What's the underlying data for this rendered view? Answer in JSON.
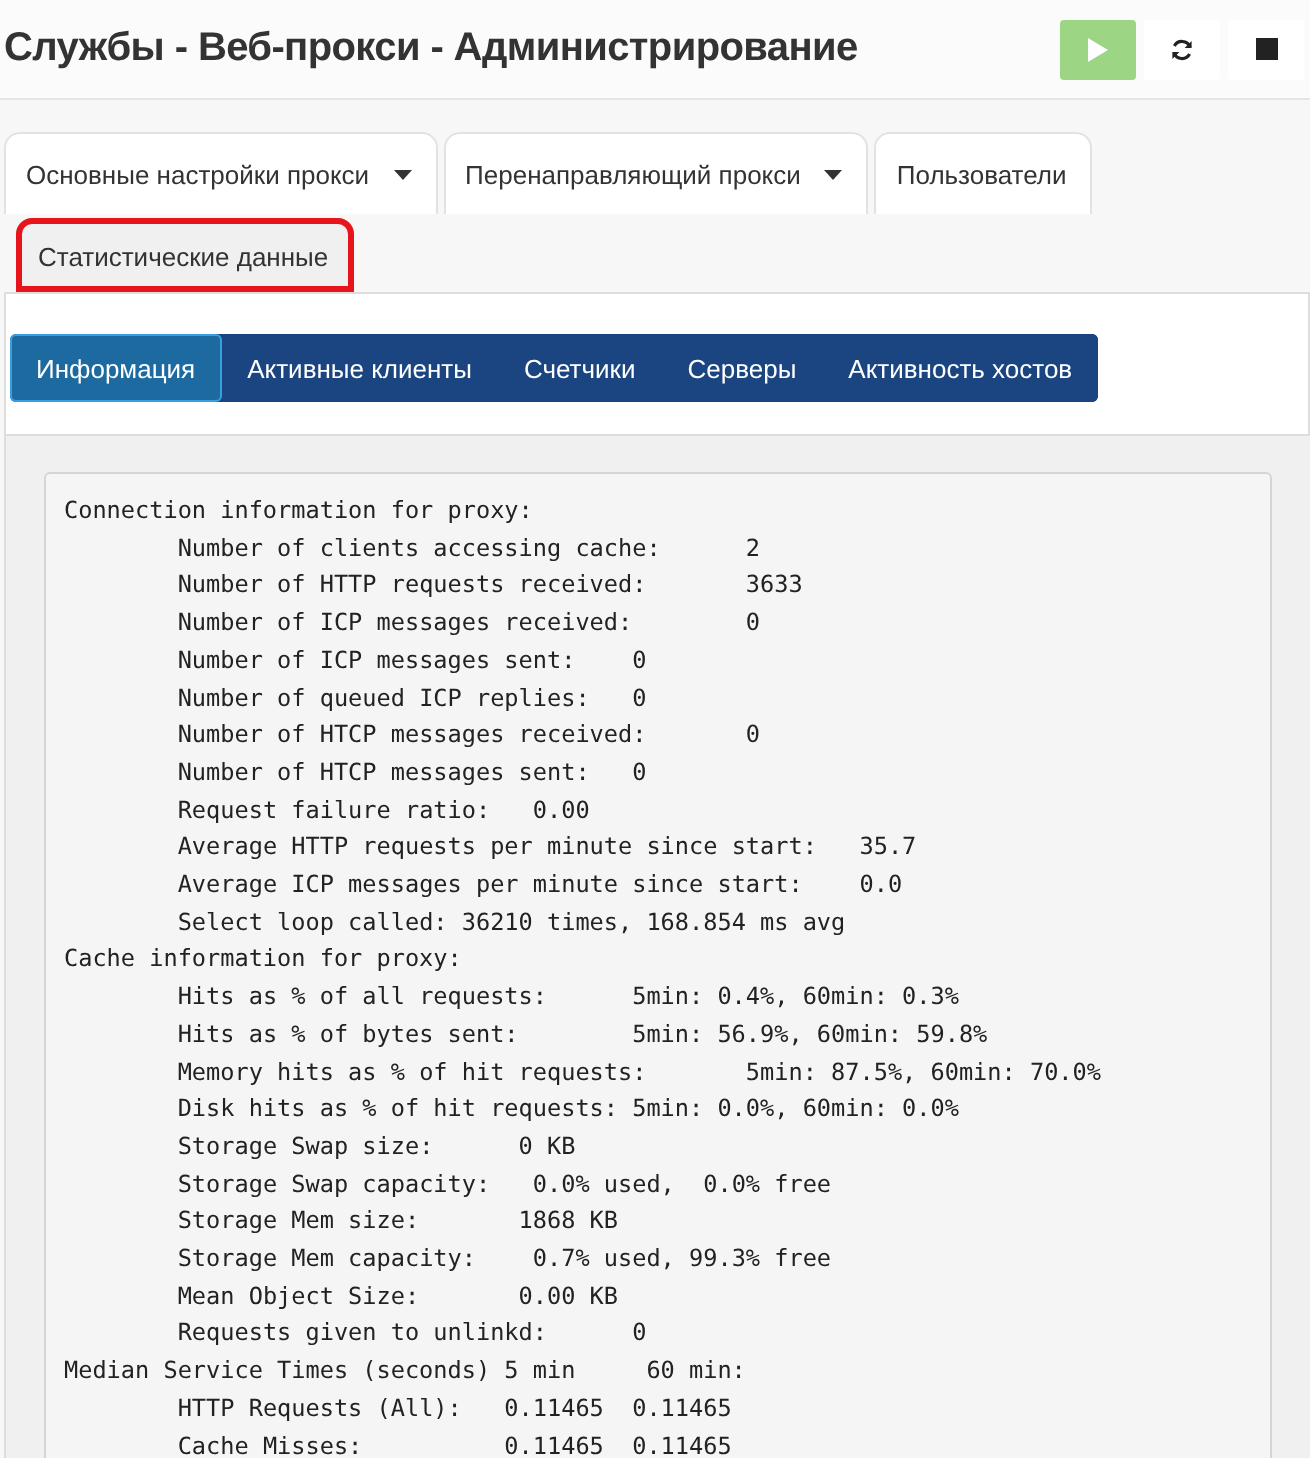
{
  "title": "Службы - Веб-прокси - Администрирование",
  "actions": [
    {
      "kind": "start",
      "disabled": true
    },
    {
      "kind": "restart",
      "disabled": false
    },
    {
      "kind": "stop",
      "disabled": false
    }
  ],
  "tabs": [
    {
      "label": "Основные настройки прокси",
      "dropdown": true,
      "selected": false,
      "highlighted": false
    },
    {
      "label": "Перенаправляющий прокси",
      "dropdown": true,
      "selected": false,
      "highlighted": false
    },
    {
      "label": "Пользователи",
      "dropdown": false,
      "selected": false,
      "highlighted": false
    },
    {
      "label": "Статистические данные",
      "dropdown": false,
      "selected": true,
      "highlighted": true
    }
  ],
  "subtabs": [
    {
      "label": "Информация",
      "selected": true
    },
    {
      "label": "Активные клиенты",
      "selected": false
    },
    {
      "label": "Счетчики",
      "selected": false
    },
    {
      "label": "Серверы",
      "selected": false
    },
    {
      "label": "Активность хостов",
      "selected": false
    }
  ],
  "output": [
    "Connection information for proxy:",
    "\tNumber of clients accessing cache:\t2",
    "\tNumber of HTTP requests received:\t3633",
    "\tNumber of ICP messages received:\t0",
    "\tNumber of ICP messages sent:\t0",
    "\tNumber of queued ICP replies:\t0",
    "\tNumber of HTCP messages received:\t0",
    "\tNumber of HTCP messages sent:\t0",
    "\tRequest failure ratio:\t 0.00",
    "\tAverage HTTP requests per minute since start:\t35.7",
    "\tAverage ICP messages per minute since start:\t0.0",
    "\tSelect loop called: 36210 times, 168.854 ms avg",
    "Cache information for proxy:",
    "\tHits as % of all requests:\t5min: 0.4%, 60min: 0.3%",
    "\tHits as % of bytes sent:\t5min: 56.9%, 60min: 59.8%",
    "\tMemory hits as % of hit requests:\t5min: 87.5%, 60min: 70.0%",
    "\tDisk hits as % of hit requests:\t5min: 0.0%, 60min: 0.0%",
    "\tStorage Swap size:\t0 KB",
    "\tStorage Swap capacity:\t 0.0% used,  0.0% free",
    "\tStorage Mem size:\t1868 KB",
    "\tStorage Mem capacity:\t 0.7% used, 99.3% free",
    "\tMean Object Size:\t0.00 KB",
    "\tRequests given to unlinkd:\t0",
    "Median Service Times (seconds) 5 min     60 min:",
    "\tHTTP Requests (All):   0.11465  0.11465",
    "\tCache Misses:          0.11465  0.11465"
  ]
}
